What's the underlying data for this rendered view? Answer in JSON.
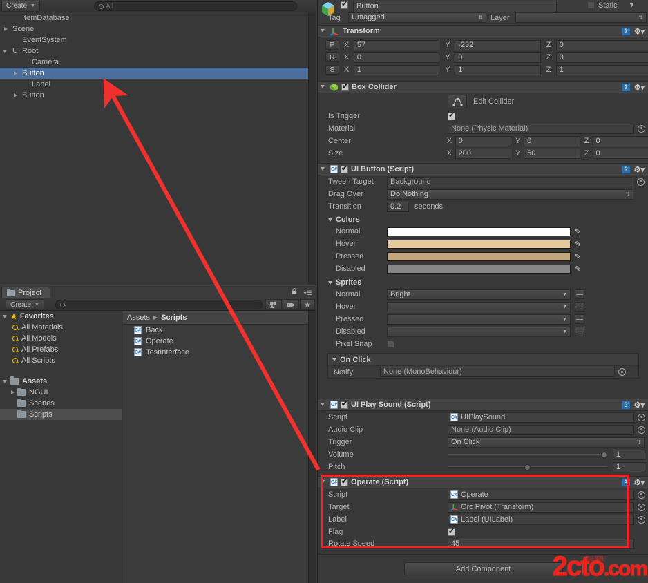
{
  "hierarchy": {
    "create_label": "Create",
    "search_placeholder": "All",
    "items": [
      {
        "label": "ItemDatabase",
        "indent": 1,
        "arrow": "none",
        "selected": false
      },
      {
        "label": "Scene",
        "indent": 0,
        "arrow": "closed",
        "selected": false
      },
      {
        "label": "EventSystem",
        "indent": 1,
        "arrow": "none",
        "selected": false
      },
      {
        "label": "UI Root",
        "indent": 0,
        "arrow": "open",
        "selected": false
      },
      {
        "label": "Camera",
        "indent": 2,
        "arrow": "none",
        "selected": false
      },
      {
        "label": "Button",
        "indent": 1,
        "arrow": "closed",
        "selected": true
      },
      {
        "label": "Label",
        "indent": 2,
        "arrow": "none",
        "selected": false
      },
      {
        "label": "Button",
        "indent": 1,
        "arrow": "closed",
        "selected": false
      }
    ]
  },
  "project": {
    "tab_label": "Project",
    "create_label": "Create",
    "search_placeholder": "",
    "favorites_label": "Favorites",
    "favorites": [
      "All Materials",
      "All Models",
      "All Prefabs",
      "All Scripts"
    ],
    "assets_label": "Assets",
    "folders": [
      {
        "label": "NGUI",
        "arrow": "closed",
        "selected": false
      },
      {
        "label": "Scenes",
        "arrow": "none",
        "selected": false
      },
      {
        "label": "Scripts",
        "arrow": "none",
        "selected": true
      }
    ],
    "breadcrumb_root": "Assets",
    "breadcrumb_current": "Scripts",
    "assets": [
      "Back",
      "Operate",
      "TestInterface"
    ]
  },
  "inspector": {
    "object_name": "Button",
    "object_enabled": true,
    "static_label": "Static",
    "static_checked": false,
    "tag_label": "Tag",
    "tag_value": "Untagged",
    "layer_label": "Layer",
    "layer_value": "",
    "transform": {
      "title": "Transform",
      "rows": [
        {
          "prefix": "P",
          "x": "57",
          "y": "-232",
          "z": "0"
        },
        {
          "prefix": "R",
          "x": "0",
          "y": "0",
          "z": "0"
        },
        {
          "prefix": "S",
          "x": "1",
          "y": "1",
          "z": "1"
        }
      ],
      "axis_labels": [
        "X",
        "Y",
        "Z"
      ]
    },
    "box_collider": {
      "title": "Box Collider",
      "enabled": true,
      "edit_collider_label": "Edit Collider",
      "is_trigger_label": "Is Trigger",
      "is_trigger": true,
      "material_label": "Material",
      "material_value": "None (Physic Material)",
      "center_label": "Center",
      "center": {
        "x": "0",
        "y": "0",
        "z": "0"
      },
      "size_label": "Size",
      "size": {
        "x": "200",
        "y": "50",
        "z": "0"
      }
    },
    "ui_button": {
      "title": "UI Button (Script)",
      "enabled": true,
      "tween_target_label": "Tween Target",
      "tween_target_value": "Background",
      "drag_over_label": "Drag Over",
      "drag_over_value": "Do Nothing",
      "transition_label": "Transition",
      "transition_value": "0.2",
      "transition_unit": "seconds",
      "colors_label": "Colors",
      "colors": [
        {
          "label": "Normal",
          "hex": "#ffffff"
        },
        {
          "label": "Hover",
          "hex": "#e4c99c"
        },
        {
          "label": "Pressed",
          "hex": "#c2a67c"
        },
        {
          "label": "Disabled",
          "hex": "#868686"
        }
      ],
      "sprites_label": "Sprites",
      "sprites": [
        {
          "label": "Normal",
          "value": "Bright"
        },
        {
          "label": "Hover",
          "value": ""
        },
        {
          "label": "Pressed",
          "value": ""
        },
        {
          "label": "Disabled",
          "value": ""
        }
      ],
      "pixel_snap_label": "Pixel Snap",
      "pixel_snap": false,
      "on_click_label": "On Click",
      "notify_label": "Notify",
      "notify_value": "None (MonoBehaviour)"
    },
    "ui_play_sound": {
      "title": "UI Play Sound (Script)",
      "enabled": true,
      "script_label": "Script",
      "script_value": "UIPlaySound",
      "audio_clip_label": "Audio Clip",
      "audio_clip_value": "None (Audio Clip)",
      "trigger_label": "Trigger",
      "trigger_value": "On Click",
      "volume_label": "Volume",
      "volume_value": "1",
      "volume_pct": 100,
      "pitch_label": "Pitch",
      "pitch_value": "1",
      "pitch_pct": 50
    },
    "operate": {
      "title": "Operate (Script)",
      "enabled": true,
      "script_label": "Script",
      "script_value": "Operate",
      "target_label": "Target",
      "target_value": "Orc Pivot (Transform)",
      "label_label": "Label",
      "label_value": "Label (UILabel)",
      "flag_label": "Flag",
      "flag": true,
      "rotate_speed_label": "Rotate Speed",
      "rotate_speed_value": "45",
      "highlight_color": "#ff1f1f"
    },
    "add_component_label": "Add Component"
  },
  "annotation": {
    "arrow_color": "#f0322e"
  },
  "watermark": {
    "main": "2cto",
    "dotcom": ".com",
    "sub": "网站源码"
  }
}
